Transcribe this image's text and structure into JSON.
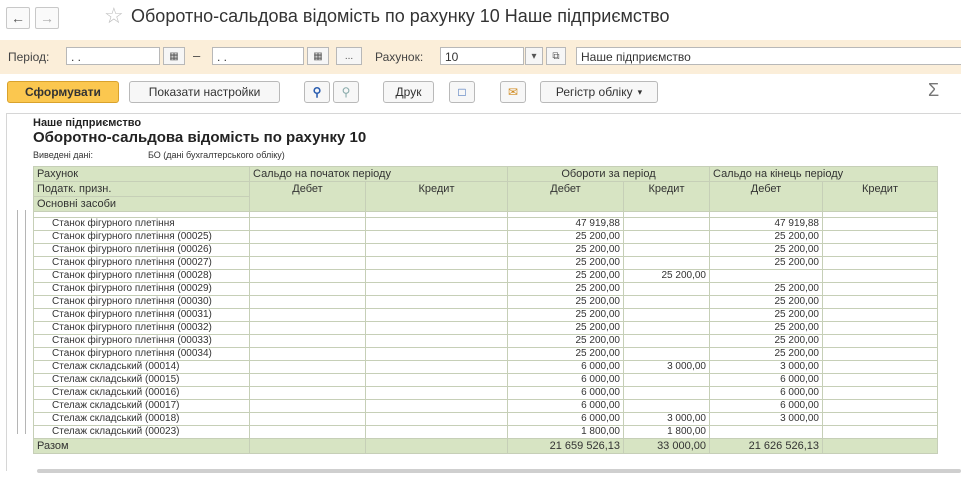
{
  "window": {
    "title": "Оборотно-сальдова відомість по рахунку 10 Наше підприємство"
  },
  "icons": {
    "back": "arrow-left-icon",
    "forward": "arrow-right-icon",
    "favorite": "star-icon"
  },
  "params": {
    "period_label": "Період:",
    "date_from": " .  .",
    "date_to": " .  .",
    "dash": "–",
    "more_label": "...",
    "account_label": "Рахунок:",
    "account_value": "10",
    "org_value": "Наше підприємство"
  },
  "toolbar": {
    "generate": "Сформувати",
    "show_settings": "Показати настройки",
    "print": "Друк",
    "register": "Регістр обліку",
    "sigma": "Σ"
  },
  "report": {
    "org": "Наше підприємство",
    "title": "Оборотно-сальдова відомість по рахунку 10",
    "data_label": "Виведені дані:",
    "data_value": "БО (дані бухгалтерського обліку)",
    "headers": {
      "account": "Рахунок",
      "tax": "Податк. призн.",
      "assets": "Основні засоби",
      "opening": "Сальдо на початок періоду",
      "turnover": "Обороти за період",
      "closing": "Сальдо на кінець періоду",
      "debit": "Дебет",
      "credit": "Кредит"
    },
    "rows": [
      {
        "name": "Станок фігурного плетіння",
        "od": "",
        "oc": "",
        "td": "47 919,88",
        "tc": "",
        "cd": "47 919,88",
        "cc": ""
      },
      {
        "name": "Станок фігурного плетіння (00025)",
        "od": "",
        "oc": "",
        "td": "25 200,00",
        "tc": "",
        "cd": "25 200,00",
        "cc": ""
      },
      {
        "name": "Станок фігурного плетіння (00026)",
        "od": "",
        "oc": "",
        "td": "25 200,00",
        "tc": "",
        "cd": "25 200,00",
        "cc": ""
      },
      {
        "name": "Станок фігурного плетіння (00027)",
        "od": "",
        "oc": "",
        "td": "25 200,00",
        "tc": "",
        "cd": "25 200,00",
        "cc": ""
      },
      {
        "name": "Станок фігурного плетіння (00028)",
        "od": "",
        "oc": "",
        "td": "25 200,00",
        "tc": "25 200,00",
        "cd": "",
        "cc": ""
      },
      {
        "name": "Станок фігурного плетіння (00029)",
        "od": "",
        "oc": "",
        "td": "25 200,00",
        "tc": "",
        "cd": "25 200,00",
        "cc": ""
      },
      {
        "name": "Станок фігурного плетіння (00030)",
        "od": "",
        "oc": "",
        "td": "25 200,00",
        "tc": "",
        "cd": "25 200,00",
        "cc": ""
      },
      {
        "name": "Станок фігурного плетіння (00031)",
        "od": "",
        "oc": "",
        "td": "25 200,00",
        "tc": "",
        "cd": "25 200,00",
        "cc": ""
      },
      {
        "name": "Станок фігурного плетіння (00032)",
        "od": "",
        "oc": "",
        "td": "25 200,00",
        "tc": "",
        "cd": "25 200,00",
        "cc": ""
      },
      {
        "name": "Станок фігурного плетіння (00033)",
        "od": "",
        "oc": "",
        "td": "25 200,00",
        "tc": "",
        "cd": "25 200,00",
        "cc": ""
      },
      {
        "name": "Станок фігурного плетіння (00034)",
        "od": "",
        "oc": "",
        "td": "25 200,00",
        "tc": "",
        "cd": "25 200,00",
        "cc": ""
      },
      {
        "name": "Стелаж складський (00014)",
        "od": "",
        "oc": "",
        "td": "6 000,00",
        "tc": "3 000,00",
        "cd": "3 000,00",
        "cc": ""
      },
      {
        "name": "Стелаж складський (00015)",
        "od": "",
        "oc": "",
        "td": "6 000,00",
        "tc": "",
        "cd": "6 000,00",
        "cc": ""
      },
      {
        "name": "Стелаж складський (00016)",
        "od": "",
        "oc": "",
        "td": "6 000,00",
        "tc": "",
        "cd": "6 000,00",
        "cc": ""
      },
      {
        "name": "Стелаж складський (00017)",
        "od": "",
        "oc": "",
        "td": "6 000,00",
        "tc": "",
        "cd": "6 000,00",
        "cc": ""
      },
      {
        "name": "Стелаж складський (00018)",
        "od": "",
        "oc": "",
        "td": "6 000,00",
        "tc": "3 000,00",
        "cd": "3 000,00",
        "cc": ""
      },
      {
        "name": "Стелаж складський (00023)",
        "od": "",
        "oc": "",
        "td": "1 800,00",
        "tc": "1 800,00",
        "cd": "",
        "cc": ""
      }
    ],
    "total": {
      "label": "Разом",
      "td": "21 659 526,13",
      "tc": "33 000,00",
      "cd": "21 626 526,13"
    }
  },
  "colors": {
    "param_bar": "#fbeed9",
    "primary_button": "#fbc74f",
    "table_header": "#d7e4c3"
  }
}
